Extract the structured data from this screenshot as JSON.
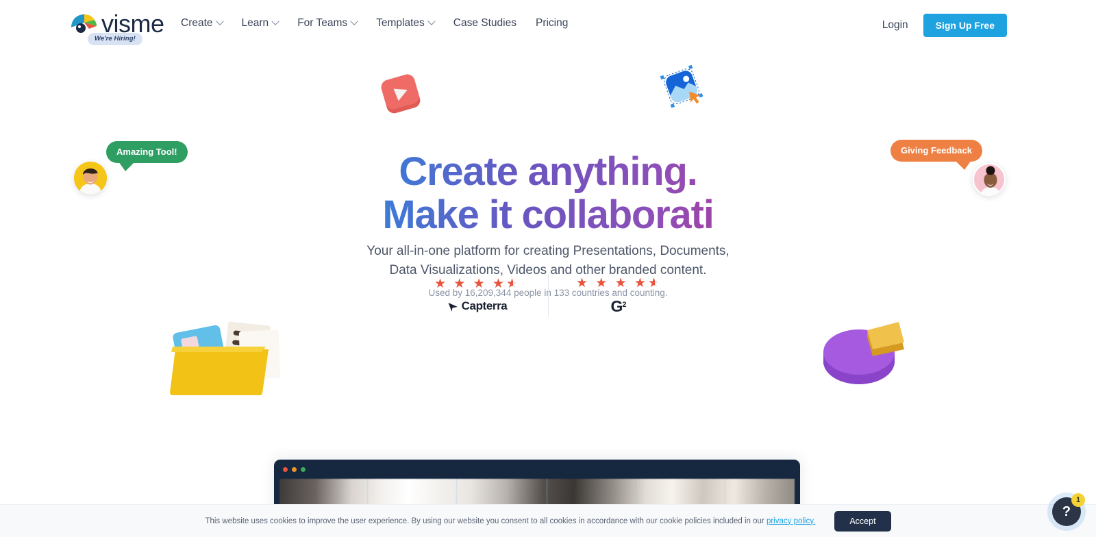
{
  "header": {
    "logo_word": "visme",
    "hiring_badge": "We're Hiring!",
    "nav": [
      {
        "label": "Create",
        "caret": true
      },
      {
        "label": "Learn",
        "caret": true
      },
      {
        "label": "For Teams",
        "caret": true
      },
      {
        "label": "Templates",
        "caret": true
      },
      {
        "label": "Case Studies",
        "caret": false
      },
      {
        "label": "Pricing",
        "caret": false
      }
    ],
    "login_label": "Login",
    "signup_label": "Sign Up Free"
  },
  "hero": {
    "headline_line1": "Create anything.",
    "headline_line2": "Make it collaborati",
    "subtitle_line1": "Your all-in-one platform for creating Presentations, Documents,",
    "subtitle_line2": "Data Visualizations, Videos and other branded content.",
    "used_by": "Used by 16,209,344 people in 133 countries and counting.",
    "bubble_left": "Amazing Tool!",
    "bubble_right": "Giving Feedback"
  },
  "ratings": [
    {
      "name": "Capterra",
      "stars": 4.5,
      "star_display": "★ ★ ★ ★",
      "half": "★"
    },
    {
      "name": "G2",
      "stars": 4.5,
      "mark": "G",
      "sup": "2"
    }
  ],
  "cookie": {
    "text_before": "This website uses cookies to improve the user experience. By using our website you consent to all cookies in accordance with our cookie policies included in our ",
    "link_label": "privacy policy.",
    "accept_label": "Accept"
  },
  "help": {
    "glyph": "?",
    "badge_count": "1"
  },
  "colors": {
    "accent_blue": "#1fa2e0",
    "star_orange": "#e8533c",
    "bubble_green": "#2f9e63",
    "bubble_orange": "#ef8043",
    "dark_navy": "#16283f",
    "badge_yellow": "#f5d233"
  }
}
